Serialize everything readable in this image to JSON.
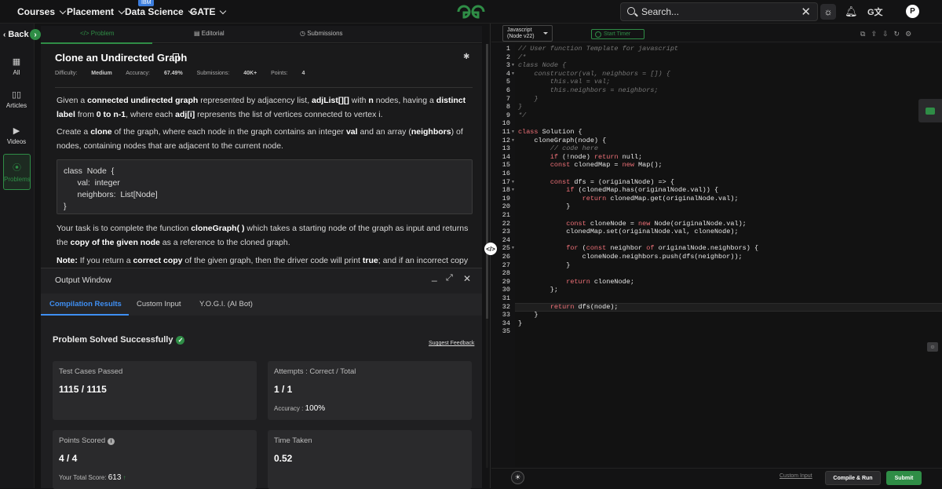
{
  "nav": {
    "items": [
      {
        "label": "Courses"
      },
      {
        "label": "Placement"
      },
      {
        "label": "Data Science"
      },
      {
        "label": "GATE"
      }
    ],
    "ibm_badge": "IBM",
    "search_placeholder": "Search...",
    "avatar_letter": "P",
    "translate_glyph": "G文"
  },
  "sidebar": {
    "back_label": "Back",
    "items": [
      {
        "label": "All",
        "icon": "grid-icon"
      },
      {
        "label": "Articles",
        "icon": "book-icon"
      },
      {
        "label": "Videos",
        "icon": "video-icon"
      },
      {
        "label": "Problems",
        "icon": "code-icon"
      }
    ]
  },
  "problem_tabs": [
    "Problem",
    "Editorial",
    "Submissions"
  ],
  "problem": {
    "title": "Clone an Undirected Graph",
    "difficulty_label": "Difficulty:",
    "difficulty": "Medium",
    "accuracy_label": "Accuracy:",
    "accuracy": "67.49%",
    "submissions_label": "Submissions:",
    "submissions": "40K+",
    "points_label": "Points:",
    "points": "4",
    "para1": {
      "a": "Given a ",
      "b": "connected undirected graph",
      "c": " represented by adjacency list, ",
      "d": "adjList[][]",
      "e": " with ",
      "f": "n",
      "g": " nodes, having a ",
      "h": "distinct label",
      "i": " from ",
      "j": "0 to n-1",
      "k": ", where each ",
      "l": "adj[i]",
      "m": " represents the list of vertices connected to vertex i."
    },
    "para2": {
      "a": "Create a ",
      "b": "clone",
      "c": " of the graph, where each node in the graph contains an integer ",
      "d": "val",
      "e": " and an array (",
      "f": "neighbors",
      "g": ") of nodes, containing nodes that are adjacent to the current node."
    },
    "class_code": "class  Node  {\n      val:  integer\n      neighbors:  List[Node]\n}",
    "para3": {
      "a": "Your task is to complete the function ",
      "b": "cloneGraph( )",
      "c": " which takes a starting node of the graph as input and returns the ",
      "d": "copy of the given node",
      "e": " as a reference to the cloned graph."
    },
    "para4": {
      "a": "Note:",
      "b": " If you return a ",
      "c": "correct copy",
      "d": " of the given graph, then the driver code will print ",
      "e": "true",
      "f": "; and if an incorrect copy"
    }
  },
  "output": {
    "title": "Output Window",
    "tabs": [
      "Compilation Results",
      "Custom Input",
      "Y.O.G.I. (AI Bot)"
    ],
    "status": "Problem Solved Successfully",
    "feedback": "Suggest Feedback",
    "cards": {
      "tests": {
        "label": "Test Cases Passed",
        "value": "1115 / 1115"
      },
      "attempts": {
        "label": "Attempts : Correct / Total",
        "value": "1 / 1",
        "sub_label": "Accuracy :",
        "sub_value": "100%"
      },
      "points": {
        "label": "Points Scored",
        "value": "4 / 4",
        "sub_label": "Your Total Score:",
        "sub_value": "613"
      },
      "time": {
        "label": "Time Taken",
        "value": "0.52"
      }
    }
  },
  "editor": {
    "language_line1": "Javascript",
    "language_line2": "(Node v22)",
    "timer_label": "Start Timer",
    "lines": [
      "// User function Template for javascript",
      "/*",
      "class Node {",
      "    constructor(val, neighbors = []) {",
      "        this.val = val;",
      "        this.neighbors = neighbors;",
      "    }",
      "}",
      "*/",
      "",
      "class Solution {",
      "    cloneGraph(node) {",
      "        // code here",
      "        if (!node) return null;",
      "        const clonedMap = new Map();",
      "",
      "        const dfs = (originalNode) => {",
      "            if (clonedMap.has(originalNode.val)) {",
      "                return clonedMap.get(originalNode.val);",
      "            }",
      "",
      "            const cloneNode = new Node(originalNode.val);",
      "            clonedMap.set(originalNode.val, cloneNode);",
      "",
      "            for (const neighbor of originalNode.neighbors) {",
      "                cloneNode.neighbors.push(dfs(neighbor));",
      "            }",
      "",
      "            return cloneNode;",
      "        };",
      "",
      "        return dfs(node);",
      "    }",
      "}",
      ""
    ],
    "custom_input_label": "Custom Input",
    "compile_label": "Compile & Run",
    "submit_label": "Submit"
  }
}
